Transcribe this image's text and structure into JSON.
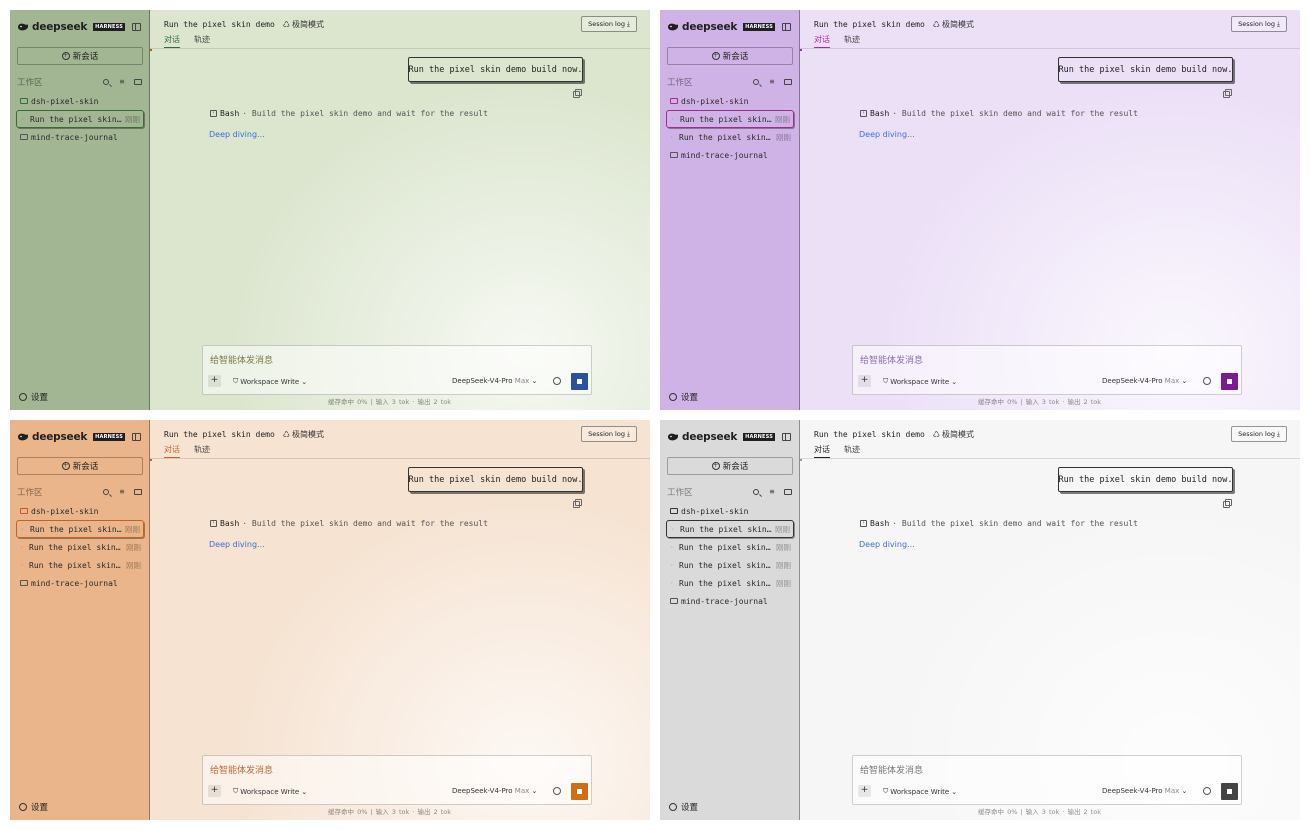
{
  "app": {
    "brand": "deepseek",
    "badge": "HARNESS",
    "new_chat_label": "新会话",
    "workspace_label": "工作区",
    "settings_label": "设置"
  },
  "header": {
    "title": "Run the pixel skin demo",
    "mode_label": "极简模式",
    "tabs": [
      "对话",
      "轨迹"
    ],
    "session_log_label": "Session log"
  },
  "chat": {
    "user_message": "Run the pixel skin demo build now.",
    "tool_name": "Bash",
    "tool_desc": "· Build the pixel skin demo and wait for the result",
    "status_text": "Deep diving..."
  },
  "composer": {
    "placeholder": "给智能体发消息",
    "workspace_mode": "Workspace Write",
    "model_name": "DeepSeek-V4-Pro",
    "model_tier": "Max",
    "stats": "缓存命中 0% | 输入 3 tok · 输出 2 tok"
  },
  "tree": {
    "folder_active": "dsh-pixel-skin",
    "folder_other": "mind-trace-journal",
    "session_name": "Run the pixel skin…",
    "session_time": "刚刚"
  },
  "themes": [
    {
      "name": "green",
      "sidebar_bg": "#a3b694",
      "main_bg": "#dce6cf",
      "accent": "#3e6a3a",
      "tab_color": "#2f6b3c",
      "composer_text": "#7d7a52",
      "stop_color": "#2d4fa0",
      "folder_color": "#3e6a3a",
      "marker": "#b35a2a",
      "session_count": 1
    },
    {
      "name": "purple",
      "sidebar_bg": "#cfb3e6",
      "main_bg": "#ece0f7",
      "accent": "#9b2f8a",
      "tab_color": "#b0289a",
      "composer_text": "#8a6fb0",
      "stop_color": "#7a1a96",
      "folder_color": "#a22f8c",
      "marker": "#8a3aa0",
      "session_count": 2
    },
    {
      "name": "orange",
      "sidebar_bg": "#eab58a",
      "main_bg": "#f6e3d2",
      "accent": "#c0622a",
      "tab_color": "#c7632a",
      "composer_text": "#c06a35",
      "stop_color": "#cf6f14",
      "folder_color": "#c05a2a",
      "marker": "#c0622a",
      "session_count": 3
    },
    {
      "name": "gray",
      "sidebar_bg": "#dadada",
      "main_bg": "#f6f6f6",
      "accent": "#333333",
      "tab_color": "#222222",
      "composer_text": "#777777",
      "stop_color": "#444444",
      "folder_color": "#333333",
      "marker": "#999999",
      "session_count": 4
    }
  ]
}
